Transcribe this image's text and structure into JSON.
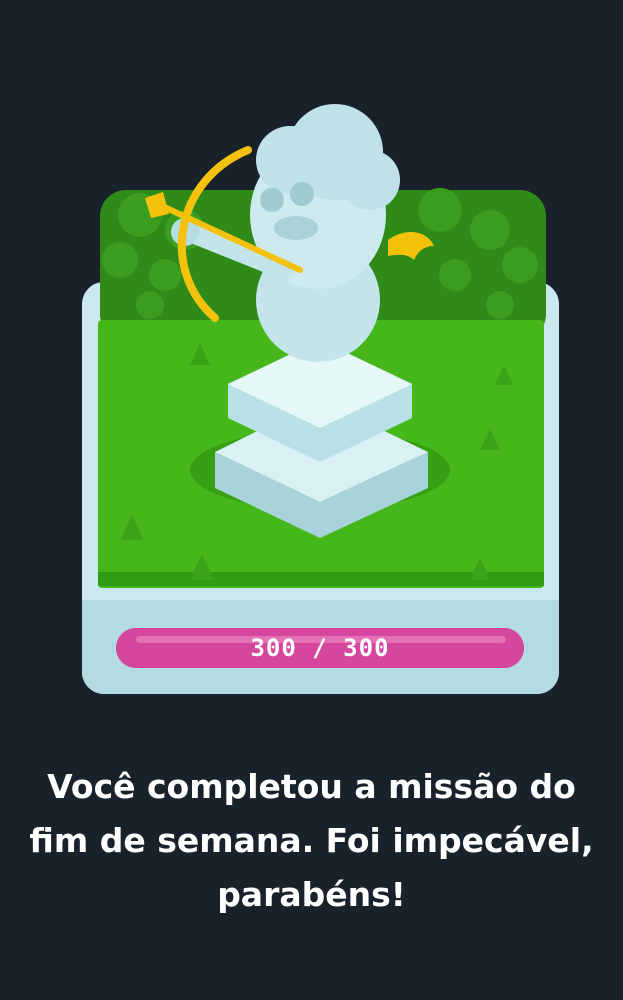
{
  "progress": {
    "current": 300,
    "total": 300,
    "fraction": 1.0,
    "label": "300 / 300",
    "color": "#c83b8a"
  },
  "message": {
    "text": "Você completou a missão do fim de semana. Foi impecável, parabéns!"
  },
  "illustration": {
    "icon": "cupid-statue-icon"
  }
}
